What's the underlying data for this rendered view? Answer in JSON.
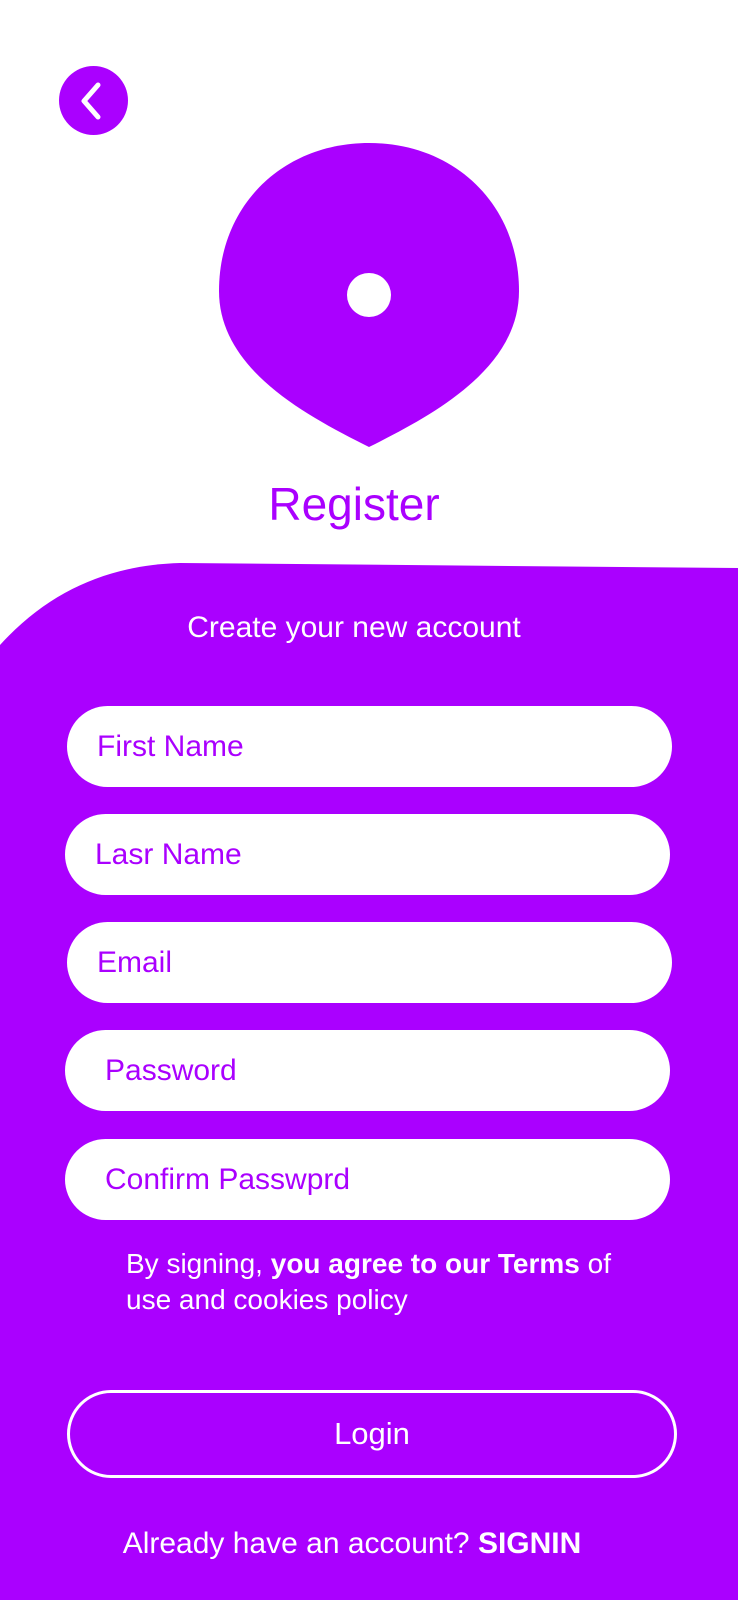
{
  "colors": {
    "accent": "#AA00FF",
    "surface": "#FFFFFF"
  },
  "header": {
    "back_icon": "chevron-left-icon",
    "logo_icon": "location-pin-icon",
    "title": "Register"
  },
  "form": {
    "subtitle": "Create your new account",
    "fields": [
      {
        "placeholder": "First Name",
        "value": ""
      },
      {
        "placeholder": "Lasr Name",
        "value": ""
      },
      {
        "placeholder": "Email",
        "value": ""
      },
      {
        "placeholder": "Password",
        "value": ""
      },
      {
        "placeholder": "Confirm Passwprd",
        "value": ""
      }
    ],
    "terms": {
      "prefix": "By signing, ",
      "bold": "you agree to our Terms",
      "suffix": " of use and cookies policy"
    },
    "submit_label": "Login",
    "signin_prompt": "Already have an account? ",
    "signin_link": "SIGNIN"
  }
}
